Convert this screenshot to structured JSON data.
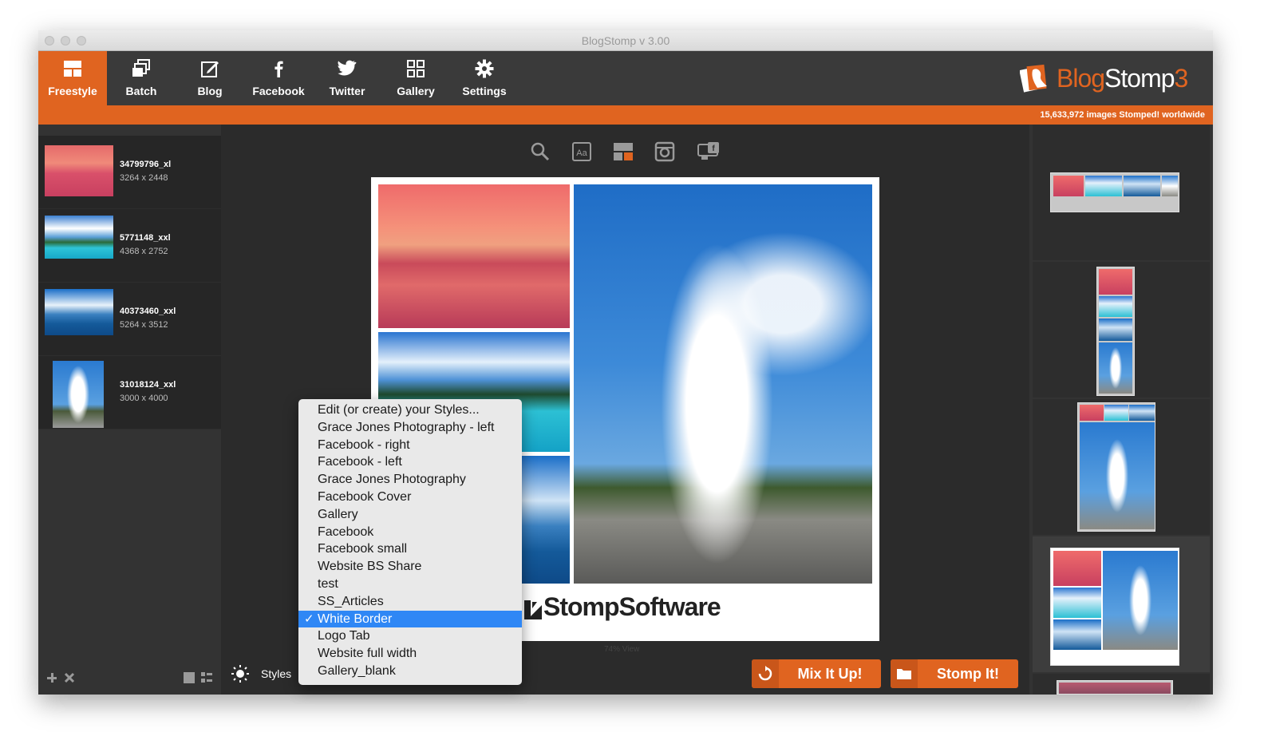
{
  "window": {
    "title": "BlogStomp v 3.00"
  },
  "toolbar": {
    "items": [
      {
        "label": "Freestyle",
        "icon": "freestyle-icon",
        "active": true
      },
      {
        "label": "Batch",
        "icon": "batch-icon"
      },
      {
        "label": "Blog",
        "icon": "blog-icon"
      },
      {
        "label": "Facebook",
        "icon": "facebook-icon"
      },
      {
        "label": "Twitter",
        "icon": "twitter-icon"
      },
      {
        "label": "Gallery",
        "icon": "gallery-icon"
      },
      {
        "label": "Settings",
        "icon": "gear-icon"
      }
    ],
    "brand": {
      "part1": "Blog",
      "part2": "Stomp",
      "part3": "3"
    }
  },
  "status": {
    "counter": "15,633,972 images Stomped! worldwide"
  },
  "images": [
    {
      "name": "34799796_xl",
      "dims": "3264 x 2448"
    },
    {
      "name": "5771148_xxl",
      "dims": "4368 x 2752"
    },
    {
      "name": "40373460_xxl",
      "dims": "5264 x 3512"
    },
    {
      "name": "31018124_xxl",
      "dims": "3000 x 4000"
    }
  ],
  "canvas": {
    "signature": "StompSoftware",
    "zoom": "74% View"
  },
  "bottom": {
    "styles_label": "Styles",
    "mix_label": "Mix It Up!",
    "stomp_label": "Stomp It!"
  },
  "styles_menu": {
    "items": [
      "Edit (or create) your Styles...",
      "Grace Jones Photography - left",
      "Facebook - right",
      "Facebook - left",
      "Grace Jones Photography",
      "Facebook Cover",
      "Gallery",
      "Facebook",
      "Facebook small",
      "Website BS Share",
      "test",
      "SS_Articles",
      "White Border",
      "Logo Tab",
      "Website full width",
      "Gallery_blank"
    ],
    "selected_index": 12
  },
  "colors": {
    "accent": "#e06420",
    "selection": "#2f87f5"
  }
}
